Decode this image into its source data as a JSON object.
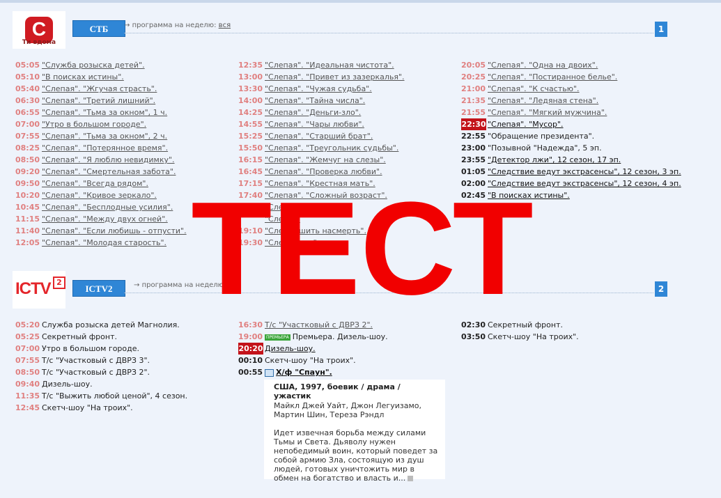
{
  "channels": [
    {
      "logo_tag": "Ти вдома",
      "name": "СТБ",
      "week_label": "программа на неделю:",
      "week_link": "вся",
      "number": "1"
    },
    {
      "logo_text": "ICTV",
      "logo_sup": "2",
      "name": "ICTV2",
      "week_label": "программа на неделю:",
      "number": "2"
    }
  ],
  "stb": {
    "col1": [
      {
        "time": "05:05",
        "title": "\"Служба розыска детей\"."
      },
      {
        "time": "05:10",
        "title": "\"В поисках истины\"."
      },
      {
        "time": "05:40",
        "title": "\"Слепая\". \"Жгучая страсть\"."
      },
      {
        "time": "06:30",
        "title": "\"Слепая\". \"Третий лишний\"."
      },
      {
        "time": "06:55",
        "title": "\"Слепая\". \"Тьма за окном\", 1 ч."
      },
      {
        "time": "07:00",
        "title": "\"Утро в большом городе\"."
      },
      {
        "time": "07:55",
        "title": "\"Слепая\". \"Тьма за окном\", 2 ч."
      },
      {
        "time": "08:25",
        "title": "\"Слепая\". \"Потерянное время\"."
      },
      {
        "time": "08:50",
        "title": "\"Слепая\". \"Я люблю невидимку\"."
      },
      {
        "time": "09:20",
        "title": "\"Слепая\". \"Смертельная забота\"."
      },
      {
        "time": "09:50",
        "title": "\"Слепая\". \"Всегда рядом\"."
      },
      {
        "time": "10:20",
        "title": "\"Слепая\". \"Кривое зеркало\"."
      },
      {
        "time": "10:45",
        "title": "\"Слепая\". \"Бесплодные усилия\"."
      },
      {
        "time": "11:15",
        "title": "\"Слепая\". \"Между двух огней\"."
      },
      {
        "time": "11:40",
        "title": "\"Слепая\". \"Если любишь - отпусти\"."
      },
      {
        "time": "12:05",
        "title": "\"Слепая\". \"Молодая старость\"."
      }
    ],
    "col2": [
      {
        "time": "12:35",
        "title": "\"Слепая\". \"Идеальная чистота\"."
      },
      {
        "time": "13:00",
        "title": "\"Слепая\". \"Привет из зазеркалья\"."
      },
      {
        "time": "13:30",
        "title": "\"Слепая\". \"Чужая судьба\"."
      },
      {
        "time": "14:00",
        "title": "\"Слепая\". \"Тайна числа\"."
      },
      {
        "time": "14:25",
        "title": "\"Слепая\". \"Деньги-зло\"."
      },
      {
        "time": "14:55",
        "title": "\"Слепая\". \"Чары любви\"."
      },
      {
        "time": "15:25",
        "title": "\"Слепая\". \"Старший брат\"."
      },
      {
        "time": "15:50",
        "title": "\"Слепая\". \"Треугольник судьбы\"."
      },
      {
        "time": "16:15",
        "title": "\"Слепая\". \"Жемчуг на слезы\"."
      },
      {
        "time": "16:45",
        "title": "\"Слепая\". \"Проверка любви\"."
      },
      {
        "time": "17:15",
        "title": "\"Слепая\". \"Крестная мать\"."
      },
      {
        "time": "17:40",
        "title": "\"Слепая\". \"Сложный возраст\"."
      },
      {
        "time": "",
        "title": "\"Сле"
      },
      {
        "time": "",
        "title": "\"Сле                      уг\"."
      },
      {
        "time": "19:10",
        "title": "\"Сле          \"Зашить насмерть\"."
      },
      {
        "time": "19:30",
        "title": "\"Сле                          а фата\"."
      }
    ],
    "col3": [
      {
        "time": "20:05",
        "title": "\"Слепая\". \"Одна на двоих\".",
        "kind": "past"
      },
      {
        "time": "20:25",
        "title": "\"Слепая\". \"Постиранное белье\".",
        "kind": "past"
      },
      {
        "time": "21:00",
        "title": "\"Слепая\". \"К счастью\".",
        "kind": "past"
      },
      {
        "time": "21:35",
        "title": "\"Слепая\". \"Ледяная стена\".",
        "kind": "past"
      },
      {
        "time": "21:55",
        "title": "\"Слепая\". \"Мягкий мужчина\".",
        "kind": "past"
      },
      {
        "time": "22:30",
        "title": "\"Слепая\". \"Мусор\".",
        "kind": "now"
      },
      {
        "time": "22:55",
        "title": "\"Обращение президента\".",
        "kind": "plain"
      },
      {
        "time": "23:00",
        "title": "\"Позывной \"Надежда\", 5 эп.",
        "kind": "plain"
      },
      {
        "time": "23:55",
        "title": "\"Детектор лжи\", 12 сезон, 17 эп.",
        "kind": "link"
      },
      {
        "time": "01:05",
        "title": "\"Следствие ведут экстрасенсы\", 12 сезон, 3 эп.",
        "kind": "link"
      },
      {
        "time": "02:00",
        "title": "\"Следствие ведут экстрасенсы\", 12 сезон, 4 эп.",
        "kind": "link"
      },
      {
        "time": "02:45",
        "title": "\"В поисках истины\".",
        "kind": "link"
      }
    ]
  },
  "ictv": {
    "col1": [
      {
        "time": "05:20",
        "title": "Служба розыска детей Магнолия."
      },
      {
        "time": "05:25",
        "title": "Секретный фронт."
      },
      {
        "time": "07:00",
        "title": "Утро в большом городе."
      },
      {
        "time": "07:55",
        "title": "Т/с \"Участковый с ДВРЗ 3\"."
      },
      {
        "time": "08:50",
        "title": "Т/с \"Участковый с ДВРЗ 2\"."
      },
      {
        "time": "09:40",
        "title": "Дизель-шоу."
      },
      {
        "time": "11:35",
        "title": "Т/с \"Выжить любой ценой\", 4 сезон."
      },
      {
        "time": "12:45",
        "title": "Скетч-шоу \"На троих\"."
      }
    ],
    "col2": [
      {
        "time": "16:30",
        "title": "Т/с \"Участковый с ДВРЗ 2\".",
        "kind": "past"
      },
      {
        "time": "19:00",
        "title": "Премьера. Дизель-шоу.",
        "kind": "premiere",
        "badge": "ПРЕМЬЕРА"
      },
      {
        "time": "20:20",
        "title": "Дизель-шоу.",
        "kind": "now"
      },
      {
        "time": "00:10",
        "title": "Скетч-шоу \"На троих\".",
        "kind": "plain"
      },
      {
        "time": "00:55",
        "title": "Х/ф \"Спаун\".",
        "kind": "film"
      }
    ],
    "col3": [
      {
        "time": "02:30",
        "title": "Секретный фронт."
      },
      {
        "time": "03:50",
        "title": "Скетч-шоу \"На троих\"."
      }
    ]
  },
  "film_info": {
    "header": "США, 1997, боевик / драма / ужастик",
    "cast": "Майкл Джей Уайт, Джон Легуизамо, Мартин Шин, Тереза Рэндл",
    "description": "Идет извечная борьба между силами Тьмы и Света. Дьяволу нужен непобедимый воин, который поведет за собой армию Зла, состоящую из душ людей, готовых уничтожить мир в обмен на богатство и власть и..."
  },
  "watermark": "ТЕСТ",
  "colors": {
    "accent": "#2f86d6",
    "now": "#c3131a",
    "past_time": "#e08080",
    "watermark": "#f10000"
  }
}
